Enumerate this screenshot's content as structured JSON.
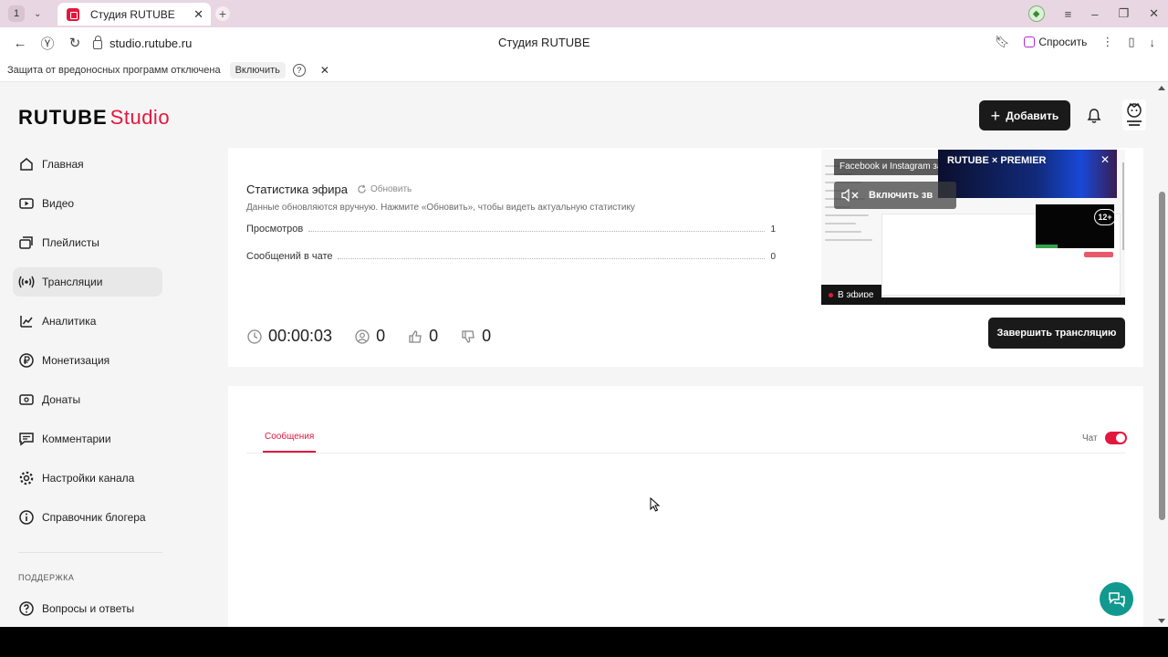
{
  "browser": {
    "tab_count": "1",
    "tab_title": "Студия RUTUBE",
    "url": "studio.rutube.ru",
    "page_title": "Студия RUTUBE",
    "ask_label": "Спросить"
  },
  "infobar": {
    "message": "Защита от вредоносных программ отключена",
    "enable_label": "Включить",
    "help_label": "?"
  },
  "header": {
    "logo_brand": "RUTUBE",
    "logo_studio": "Studio",
    "add_label": "Добавить"
  },
  "sidebar": {
    "items": [
      {
        "label": "Главная",
        "icon": "home-icon"
      },
      {
        "label": "Видео",
        "icon": "video-icon"
      },
      {
        "label": "Плейлисты",
        "icon": "playlists-icon"
      },
      {
        "label": "Трансляции",
        "icon": "broadcast-icon",
        "active": true
      },
      {
        "label": "Аналитика",
        "icon": "analytics-icon"
      },
      {
        "label": "Монетизация",
        "icon": "ruble-icon"
      },
      {
        "label": "Донаты",
        "icon": "donate-icon"
      },
      {
        "label": "Комментарии",
        "icon": "comments-icon"
      },
      {
        "label": "Настройки канала",
        "icon": "gear-icon"
      },
      {
        "label": "Справочник блогера",
        "icon": "info-icon"
      }
    ],
    "support_heading": "ПОДДЕРЖКА",
    "support_items": [
      {
        "label": "Вопросы и ответы",
        "icon": "faq-icon"
      }
    ]
  },
  "stats": {
    "title": "Статистика эфира",
    "refresh_label": "Обновить",
    "hint": "Данные обновляются вручную. Нажмите «Обновить», чтобы видеть актуальную статистику",
    "rows": [
      {
        "label": "Просмотров",
        "value": "1"
      },
      {
        "label": "Сообщений в чате",
        "value": "0"
      }
    ],
    "duration": "00:00:03",
    "viewers": "0",
    "likes": "0",
    "dislikes": "0",
    "end_label": "Завершить трансляцию"
  },
  "preview": {
    "overlay_text": "Facebook и Instagram за",
    "premier_text": "RUTUBE × PREMIER",
    "sound_label": "Включить зв",
    "age_badge": "12+",
    "live_label": "В эфире"
  },
  "chat": {
    "tab_label": "Сообщения",
    "toggle_label": "Чат",
    "toggle_on": true
  },
  "colors": {
    "accent": "#e3173e",
    "dark_button": "#1a1a1a",
    "help_fab": "#11998f"
  }
}
